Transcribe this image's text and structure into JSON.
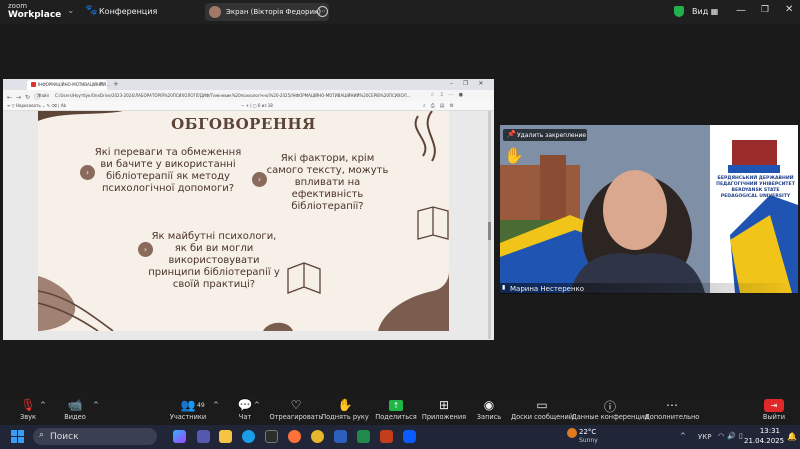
{
  "topbar": {
    "logo_line1": "zoom",
    "logo_line2": "Workplace",
    "conference_label": "Конференция",
    "share_label": "Экран (Вікторія Федорик)",
    "view_label": "Вид"
  },
  "browser": {
    "tab_title": "ІНФОРМАЦІЙНО-МОТИВАЦІЙНИЙ...",
    "url_file_label": "Файл",
    "url": "C:/Users/Ноутбук/OneDrive/2023-2024/ЛАБОРАТОРІЯ%20ПСИХОЛОГІЇ/ДИФ/Тижневик%20психологічної%20-2025/ІНФОРМАЦІЙНО-МОТИВАЦІЙНИЙ%20СЕРІВ%20ПСИХОЛ...",
    "draw_label": "Нарисовать",
    "page_current": "6",
    "page_total": "из 18"
  },
  "slide": {
    "title": "ОБГОВОРЕННЯ",
    "q1": "Які переваги та обмеження ви бачите у використанні бібліотерапії як методу психологічної допомоги?",
    "q2": "Які фактори, крім самого тексту, можуть впливати на ефективність бібліотерапії?",
    "q3": "Як майбутні психологи, як би ви могли використовувати принципи бібліотерапії у своїй практиці?"
  },
  "speaker": {
    "unpin_label": "Удалить закрепление",
    "name": "Марина Нестеренко",
    "university_text": "БЕРДЯНСЬКИЙ ДЕРЖАВНИЙ ПЕДАГОГІЧНИЙ УНІВЕРСИТЕТ BERDYANSK STATE PEDAGOGICAL UNIVERSITY"
  },
  "toolbar": {
    "mute": "Звук",
    "video": "Видео",
    "participants": "Участники",
    "participants_count": "49",
    "chat": "Чат",
    "react": "Отреагировать",
    "raise_hand": "Поднять руку",
    "share": "Поделиться",
    "apps": "Приложения",
    "record": "Запись",
    "whiteboard": "Доски сообщений",
    "meeting_data": "Данные конференции",
    "more": "Дополнительно",
    "exit": "Выйти"
  },
  "taskbar": {
    "search_label": "Поиск",
    "weather_temp": "22°C",
    "weather_desc": "Sunny",
    "lang": "УКР",
    "time": "13:31",
    "date": "21.04.2025",
    "notification_count": "1"
  },
  "colors": {
    "zoom_blue": "#0b5cff",
    "share_green": "#1fb547",
    "leave_red": "#e02828",
    "slide_bg": "#f6f0e9",
    "slide_brown": "#8a6a5c"
  }
}
